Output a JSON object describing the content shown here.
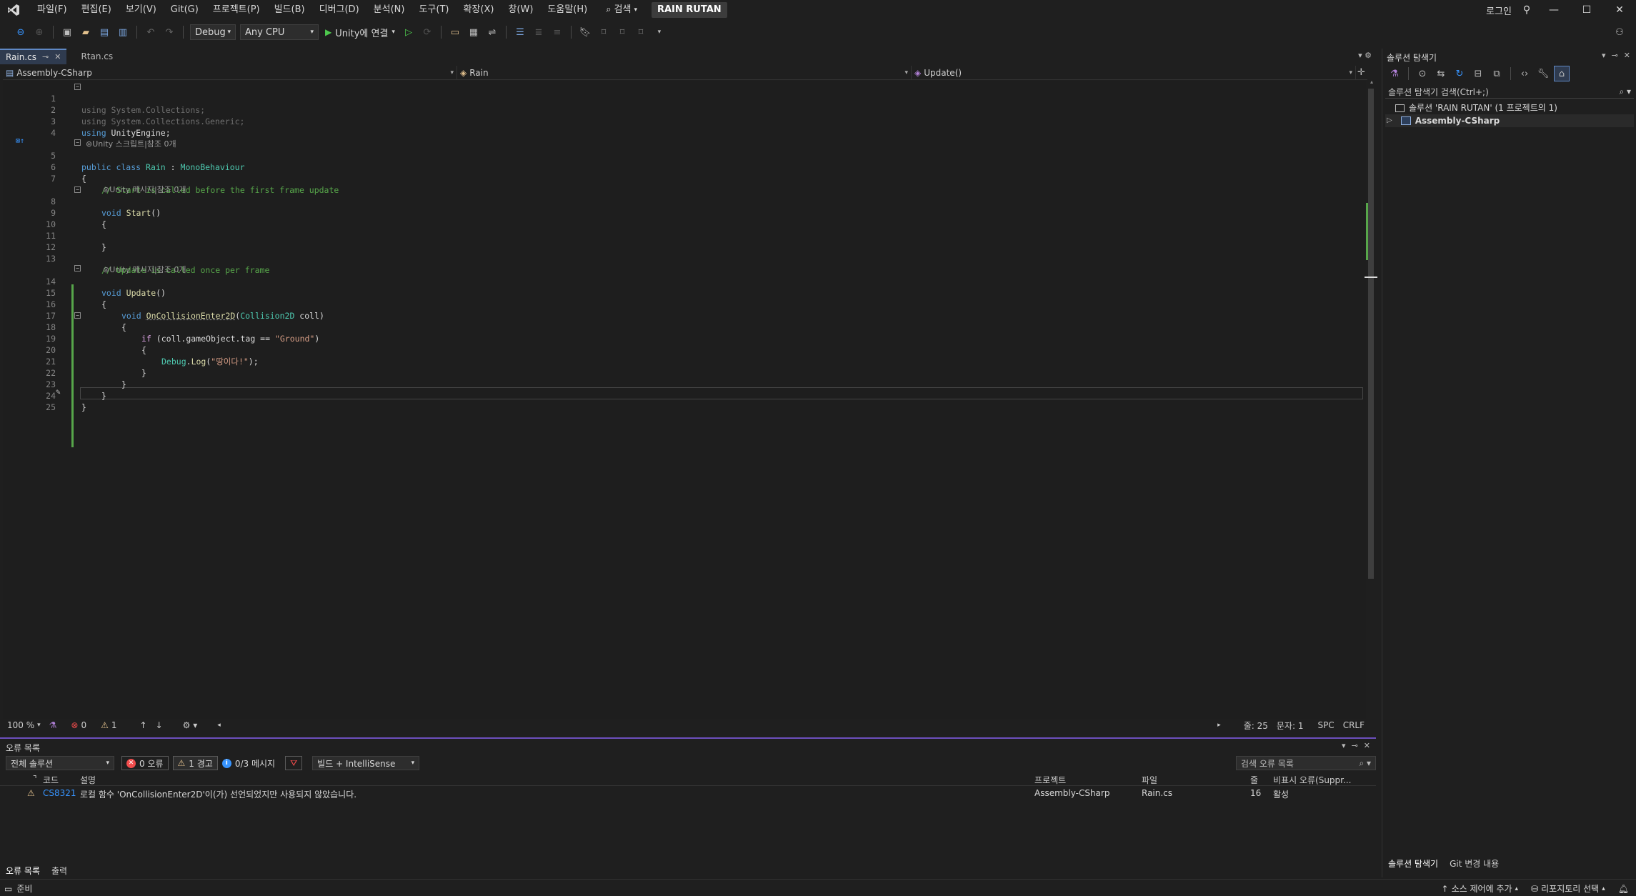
{
  "menu": {
    "items": [
      "파일(F)",
      "편집(E)",
      "보기(V)",
      "Git(G)",
      "프로젝트(P)",
      "빌드(B)",
      "디버그(D)",
      "분석(N)",
      "도구(T)",
      "확장(X)",
      "창(W)",
      "도움말(H)"
    ],
    "search_label": "검색",
    "solution_name": "RAIN RUTAN",
    "login_label": "로그인"
  },
  "toolbar": {
    "config": "Debug",
    "platform": "Any CPU",
    "run_label": "Unity에 연결"
  },
  "tabs": [
    {
      "label": "Rain.cs",
      "active": true
    },
    {
      "label": "Rtan.cs",
      "active": false
    }
  ],
  "navbar": {
    "project": "Assembly-CSharp",
    "type": "Rain",
    "member": "Update()"
  },
  "code_lens": {
    "unity_script": "Unity 스크립트|참조 0개",
    "unity_message_1": "Unity 메시지|참조 0개",
    "unity_message_2": "Unity 메시지|참조 0개"
  },
  "code": {
    "l1": "using System.Collections;",
    "l2": "using System.Collections.Generic;",
    "l3_kw": "using",
    "l3_rest": " UnityEngine;",
    "l5_kw": "public class",
    "l5_type": "Rain",
    "l5_sep": " : ",
    "l5_base": "MonoBehaviour",
    "l6": "{",
    "l7": "// Start is called before the first frame update",
    "l8_kw": "void",
    "l8_fn": "Start",
    "l8_rest": "()",
    "l9": "{",
    "l11": "}",
    "l13": "// Update is called once per frame",
    "l14_kw": "void",
    "l14_fn": "Update",
    "l14_rest": "()",
    "l15": "{",
    "l16_kw": "void",
    "l16_fn": "OnCollisionEnter2D",
    "l16_open": "(",
    "l16_type": "Collision2D",
    "l16_rest": " coll)",
    "l17": "{",
    "l18_kw": "if",
    "l18_mid": " (coll.gameObject.tag == ",
    "l18_str": "\"Ground\"",
    "l18_end": ")",
    "l19": "{",
    "l20_type": "Debug",
    "l20_dot": ".",
    "l20_fn": "Log",
    "l20_open": "(",
    "l20_str": "\"땅이다!\"",
    "l20_end": ");",
    "l21": "}",
    "l22": "}",
    "l23": "}",
    "l24": "}"
  },
  "line_numbers": [
    "1",
    "2",
    "3",
    "4",
    "5",
    "6",
    "7",
    "8",
    "9",
    "10",
    "11",
    "12",
    "13",
    "14",
    "15",
    "16",
    "17",
    "18",
    "19",
    "20",
    "21",
    "22",
    "23",
    "24",
    "25"
  ],
  "editor_status": {
    "zoom": "100 %",
    "errors": "0",
    "warnings": "1",
    "line": "줄: 25",
    "col": "문자: 1",
    "whitespace": "SPC",
    "eol": "CRLF"
  },
  "error_list": {
    "title": "오류 목록",
    "scope": "전체 솔루션",
    "errors_btn": "0 오류",
    "warnings_btn": "1 경고",
    "messages_btn": "0/3 메시지",
    "source": "빌드 + IntelliSense",
    "search_placeholder": "검색 오류 목록",
    "columns": {
      "code": "코드",
      "desc": "설명",
      "project": "프로젝트",
      "file": "파일",
      "line": "줄",
      "suppress": "비표시 오류(Suppr..."
    },
    "rows": [
      {
        "code": "CS8321",
        "desc": "로컬 함수 'OnCollisionEnter2D'이(가) 선언되었지만 사용되지 않았습니다.",
        "project": "Assembly-CSharp",
        "file": "Rain.cs",
        "line": "16",
        "suppress": "활성"
      }
    ],
    "bottom_tabs": [
      "오류 목록",
      "출력"
    ]
  },
  "solution_explorer": {
    "title": "솔루션 탐색기",
    "search_placeholder": "솔루션 탐색기 검색(Ctrl+;)",
    "solution_item": "솔루션 'RAIN RUTAN' (1 프로젝트의 1)",
    "project_item": "Assembly-CSharp",
    "bottom_tabs": [
      "솔루션 탐색기",
      "Git 변경 내용"
    ]
  },
  "statusbar": {
    "ready": "준비",
    "source_control": "소스 제어에 추가",
    "repo": "리포지토리 선택"
  },
  "colors": {
    "accent": "#6c4fbd",
    "keyword": "#569cd6",
    "type": "#4ec9b0",
    "comment": "#57a64a",
    "string": "#d69d85",
    "error": "#f14c4c",
    "warning": "#e2c08d"
  }
}
